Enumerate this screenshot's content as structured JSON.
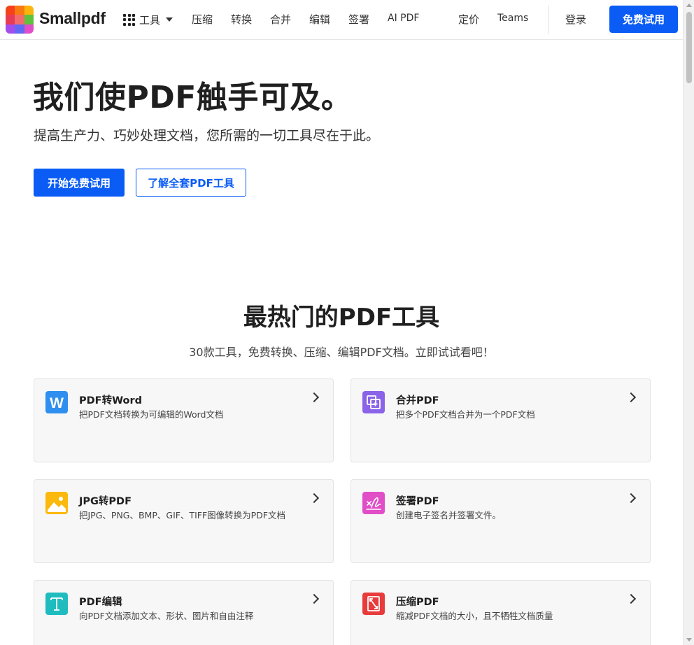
{
  "brand": {
    "name": "Smallpdf",
    "logo_colors": [
      "#f5421b",
      "#fa7a12",
      "#fcb50d",
      "#e83b55",
      "#f26c6c",
      "#5fc23d",
      "#a34ded",
      "#6367f2",
      "#e14ec7"
    ]
  },
  "nav": {
    "tools_label": "工具",
    "items": [
      "压缩",
      "转换",
      "合并",
      "编辑",
      "签署",
      "AI PDF"
    ],
    "pricing": "定价",
    "teams": "Teams",
    "login": "登录",
    "trial": "免费试用"
  },
  "hero": {
    "title": "我们使PDF触手可及。",
    "subtitle": "提高生产力、巧妙处理文档，您所需的一切工具尽在于此。",
    "primary_cta": "开始免费试用",
    "secondary_cta": "了解全套PDF工具"
  },
  "section": {
    "title": "最热门的PDF工具",
    "subtitle": "30款工具，免费转换、压缩、编辑PDF文档。立即试试看吧！"
  },
  "tools": [
    {
      "title": "PDF转Word",
      "desc": "把PDF文档转换为可编辑的Word文档",
      "icon": "word-icon",
      "color": "#2f8ff0"
    },
    {
      "title": "合并PDF",
      "desc": "把多个PDF文档合并为一个PDF文档",
      "icon": "merge-icon",
      "color": "#8a63e8"
    },
    {
      "title": "JPG转PDF",
      "desc": "把JPG、PNG、BMP、GIF、TIFF图像转换为PDF文档",
      "icon": "image-icon",
      "color": "#fbb80d"
    },
    {
      "title": "签署PDF",
      "desc": "创建电子签名并签署文件。",
      "icon": "signature-icon",
      "color": "#e14ec7"
    },
    {
      "title": "PDF编辑",
      "desc": "向PDF文档添加文本、形状、图片和自由注释",
      "icon": "text-icon",
      "color": "#1fbcbf"
    },
    {
      "title": "压缩PDF",
      "desc": "缩减PDF文档的大小，且不牺牲文档质量",
      "icon": "compress-icon",
      "color": "#e83b3b"
    }
  ]
}
